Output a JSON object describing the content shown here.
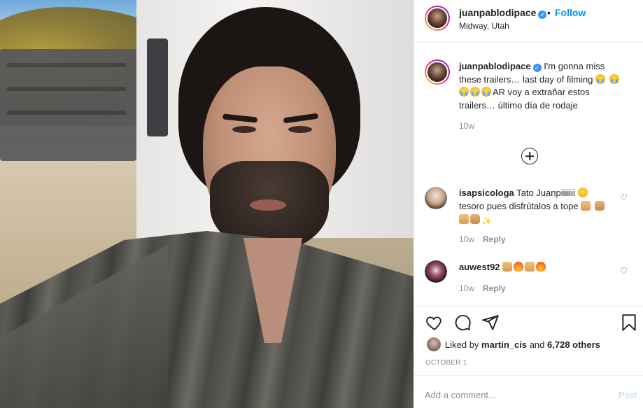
{
  "post": {
    "username": "juanpablodipace",
    "verified_mark": "✓",
    "dot": "•",
    "follow_label": "Follow",
    "location": "Midway, Utah"
  },
  "caption": {
    "username": "juanpablodipace",
    "text_part1": " I'm gonna miss these trailers… last day of filming ",
    "text_part2": "AR voy a extrañar estos trailers… último día de rodaje",
    "time": "10w"
  },
  "comments": [
    {
      "username": "isapsicologa",
      "text": " Tato Juanpiiiiiii ",
      "text2": "tesoro pues disfrútalos a tope ",
      "time": "10w",
      "reply_label": "Reply"
    },
    {
      "username": "auwest92",
      "text": " ",
      "time": "10w",
      "reply_label": "Reply"
    }
  ],
  "likes": {
    "prefix": "Liked by ",
    "user": "martin_cis",
    "middle": " and ",
    "count": "6,728 others"
  },
  "date": "OCTOBER 1",
  "add_comment": {
    "placeholder": "Add a comment...",
    "post_label": "Post"
  },
  "icons": {
    "heart": "heart-icon",
    "comment": "comment-icon",
    "share": "share-icon",
    "save": "bookmark-icon",
    "more": "plus-circle-icon"
  },
  "colors": {
    "accent": "#0095f6",
    "muted": "#8e8e8e",
    "text": "#262626",
    "verified": "#3897f0",
    "post_disabled": "#b3dbff"
  }
}
